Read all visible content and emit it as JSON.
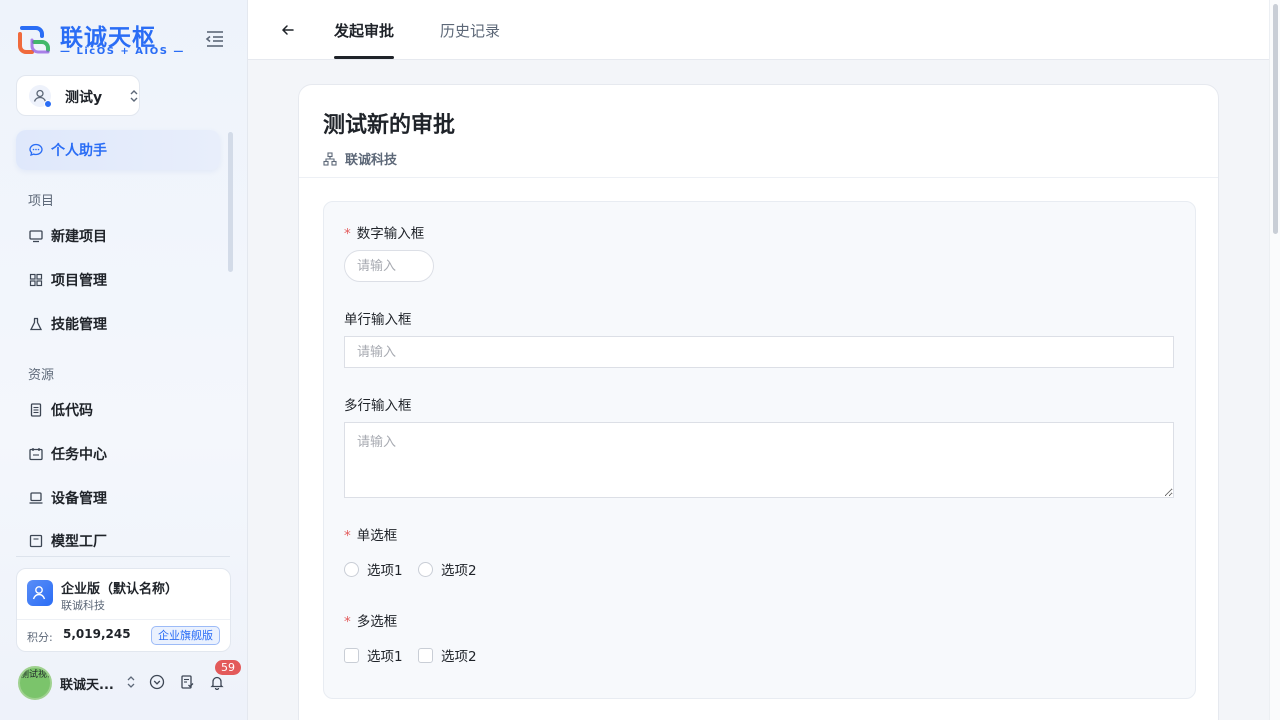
{
  "brand": {
    "title": "联诚天枢",
    "subtitle": "— LicOS + AIOS —",
    "colors": {
      "primary": "#2a6df5",
      "danger": "#e35a5a"
    }
  },
  "sidebar": {
    "current_user": "测试y",
    "active_item": "个人助手",
    "sections": [
      {
        "title": "项目",
        "items": [
          "新建项目",
          "项目管理",
          "技能管理"
        ]
      },
      {
        "title": "资源",
        "items": [
          "低代码",
          "任务中心",
          "设备管理",
          "模型工厂"
        ]
      }
    ],
    "icons": [
      "chat-icon",
      "monitor-icon",
      "grid-icon",
      "flask-icon",
      "document-icon",
      "calendar-icon",
      "laptop-icon",
      "factory-icon"
    ],
    "org": {
      "name": "企业版（默认名称）",
      "company": "联诚科技",
      "points_label": "积分:",
      "points": "5,019,245",
      "plan_badge": "企业旗舰版"
    },
    "footer": {
      "avatar_text": "测试视山",
      "username": "联诚天...",
      "notification_count": "59"
    }
  },
  "topbar": {
    "tabs": [
      "发起审批",
      "历史记录"
    ],
    "active_tab": "发起审批"
  },
  "form": {
    "title": "测试新的审批",
    "organization": "联诚科技",
    "required_mark": "*",
    "fields": {
      "number": {
        "label": "数字输入框",
        "placeholder": "请输入",
        "required": true
      },
      "single_line": {
        "label": "单行输入框",
        "placeholder": "请输入",
        "required": false
      },
      "multi_line": {
        "label": "多行输入框",
        "placeholder": "请输入",
        "required": false
      },
      "radio": {
        "label": "单选框",
        "required": true,
        "options": [
          "选项1",
          "选项2"
        ]
      },
      "checkbox": {
        "label": "多选框",
        "required": true,
        "options": [
          "选项1",
          "选项2"
        ]
      }
    }
  }
}
